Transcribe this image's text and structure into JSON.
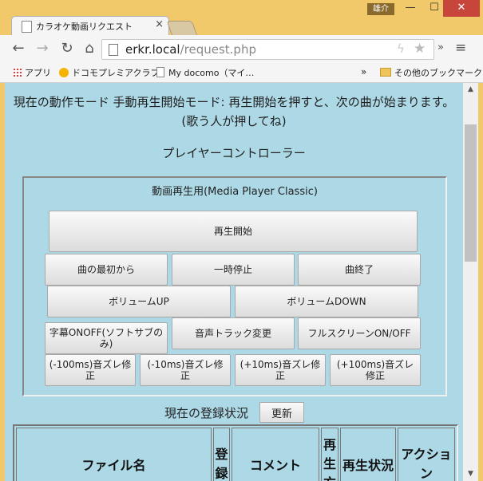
{
  "window": {
    "user_badge": "雄介",
    "min_icon": "—",
    "max_icon": "☐",
    "close_icon": "✕"
  },
  "tab": {
    "title": "カラオケ動画リクエスト",
    "close_icon": "×"
  },
  "toolbar": {
    "back_icon": "←",
    "forward_icon": "→",
    "reload_icon": "↻",
    "home_icon": "⌂",
    "url_host": "erkr.local",
    "url_path": "/request.php",
    "bolt_icon": "ϟ",
    "star_icon": "★",
    "chevron_icon": "»",
    "menu_icon": "≡"
  },
  "bookmarks": {
    "apps": "アプリ",
    "docomo_club": "ドコモプレミアクラブ",
    "my_docomo": "My docomo（マイ…",
    "more": "»",
    "other": "その他のブックマーク"
  },
  "page": {
    "mode_text": "現在の動作モード 手動再生開始モード: 再生開始を押すと、次の曲が始まります。(歌う人が押してね)",
    "controller_title": "プレイヤーコントローラー",
    "player_legend": "動画再生用(Media Player Classic)",
    "buttons": {
      "play_start": "再生開始",
      "from_beginning": "曲の最初から",
      "pause": "一時停止",
      "end_song": "曲終了",
      "volume_up": "ボリュームUP",
      "volume_down": "ボリュームDOWN",
      "subtitle_toggle": "字幕ONOFF(ソフトサブのみ)",
      "audio_track": "音声トラック変更",
      "fullscreen": "フルスクリーンON/OFF",
      "offset_m100": "(-100ms)音ズレ修正",
      "offset_m10": "(-10ms)音ズレ修正",
      "offset_p10": "(+10ms)音ズレ修正",
      "offset_p100": "(+100ms)音ズレ修正"
    },
    "registration_label": "現在の登録状況",
    "refresh_button": "更新",
    "table_headers": {
      "file": "ファイル名",
      "registrant": "登録",
      "comment": "コメント",
      "play": "再生方",
      "status": "再生状況",
      "action": "アクション"
    }
  },
  "scrollbar": {
    "up_icon": "▲",
    "down_icon": "▼"
  }
}
